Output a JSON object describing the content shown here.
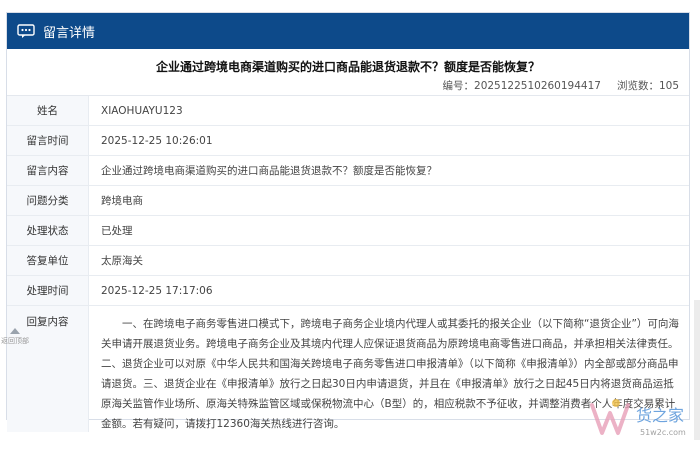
{
  "header": {
    "title": "留言详情",
    "icon": "chat-icon"
  },
  "question_title": "企业通过跨境电商渠道购买的进口商品能退货退款不？额度是否能恢复？",
  "meta": {
    "number_label": "编号：",
    "number": "2025122510260194417",
    "views_label": "浏览数：",
    "views": "105"
  },
  "rows": [
    {
      "label": "姓名",
      "value": "XIAOHUAYU123"
    },
    {
      "label": "留言时间",
      "value": "2025-12-25 10:26:01"
    },
    {
      "label": "留言内容",
      "value": "企业通过跨境电商渠道购买的进口商品能退货退款不？额度是否能恢复？"
    },
    {
      "label": "问题分类",
      "value": "跨境电商"
    },
    {
      "label": "处理状态",
      "value": "已处理"
    },
    {
      "label": "答复单位",
      "value": "太原海关"
    },
    {
      "label": "处理时间",
      "value": "2025-12-25 17:17:06"
    }
  ],
  "reply": {
    "label": "回复内容",
    "text": "一、在跨境电子商务零售进口模式下，跨境电子商务企业境内代理人或其委托的报关企业（以下简称“退货企业”）可向海关申请开展退货业务。跨境电子商务企业及其境内代理人应保证退货商品为原跨境电商零售进口商品，并承担相关法律责任。二、退货企业可以对原《中华人民共和国海关跨境电子商务零售进口申报清单》（以下简称《申报清单》）内全部或部分商品申请退货。三、退货企业在《申报清单》放行之日起30日内申请退货，并且在《申报清单》放行之日起45日内将退货商品运抵原海关监管作业场所、原海关特殊监管区域或保税物流中心（B型）的，相应税款不予征收，并调整消费者个人年度交易累计金额。若有疑问，请拨打12360海关热线进行咨询。"
  },
  "back_to_top": "返回顶部",
  "watermark": {
    "brand": "货之家",
    "domain": "51w2c.com"
  },
  "colors": {
    "header_bg": "#0d4a8a",
    "label_bg": "#f6f8fb",
    "border": "#e8ecf1"
  }
}
